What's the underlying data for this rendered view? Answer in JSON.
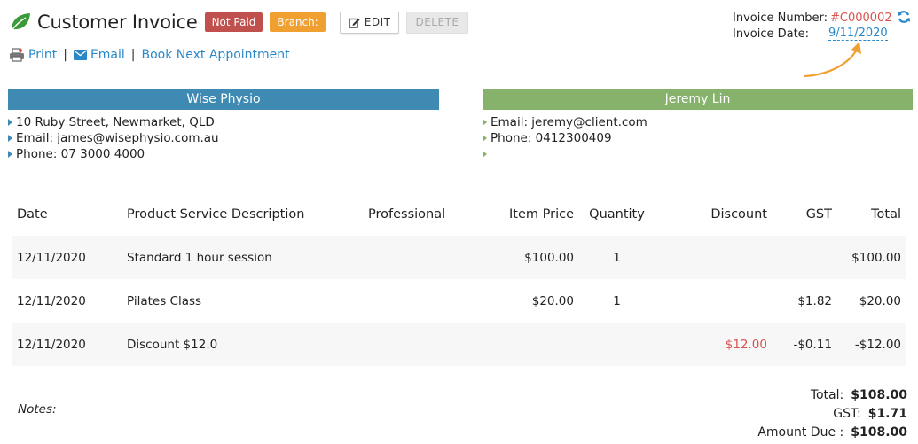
{
  "header": {
    "title": "Customer Invoice",
    "status_badge": "Not Paid",
    "branch_badge": "Branch:",
    "edit_label": "EDIT",
    "delete_label": "DELETE"
  },
  "links": {
    "print": "Print",
    "email": "Email",
    "book": "Book Next Appointment",
    "separator": "|"
  },
  "invoice": {
    "number_label": "Invoice Number:",
    "number": "#C000002",
    "date_label": "Invoice Date:",
    "date": "9/11/2020"
  },
  "business": {
    "name": "Wise Physio",
    "address": "10 Ruby Street, Newmarket, QLD",
    "email": "Email: james@wisephysio.com.au",
    "phone": "Phone: 07 3000 4000"
  },
  "client": {
    "name": "Jeremy Lin",
    "email": "Email: jeremy@client.com",
    "phone": "Phone: 0412300409",
    "extra": ""
  },
  "table": {
    "headers": [
      "Date",
      "Product Service Description",
      "Professional",
      "Item Price",
      "Quantity",
      "Discount",
      "GST",
      "Total"
    ],
    "rows": [
      {
        "date": "12/11/2020",
        "desc": "Standard 1 hour session",
        "professional": "",
        "price": "$100.00",
        "qty": "1",
        "discount": "",
        "gst": "",
        "total": "$100.00"
      },
      {
        "date": "12/11/2020",
        "desc": "Pilates Class",
        "professional": "",
        "price": "$20.00",
        "qty": "1",
        "discount": "",
        "gst": "$1.82",
        "total": "$20.00"
      },
      {
        "date": "12/11/2020",
        "desc": "Discount $12.0",
        "professional": "",
        "price": "",
        "qty": "",
        "discount": "$12.00",
        "gst": "-$0.11",
        "total": "-$12.00"
      }
    ]
  },
  "notes_label": "Notes:",
  "totals": {
    "total_label": "Total:",
    "total": "$108.00",
    "gst_label": "GST:",
    "gst": "$1.71",
    "due_label": "Amount Due :",
    "due": "$108.00"
  },
  "colors": {
    "accent_blue": "#3e8ab3",
    "accent_green": "#87b26c",
    "danger": "#d9534f",
    "warning": "#f0a030",
    "link": "#2a88c8"
  }
}
